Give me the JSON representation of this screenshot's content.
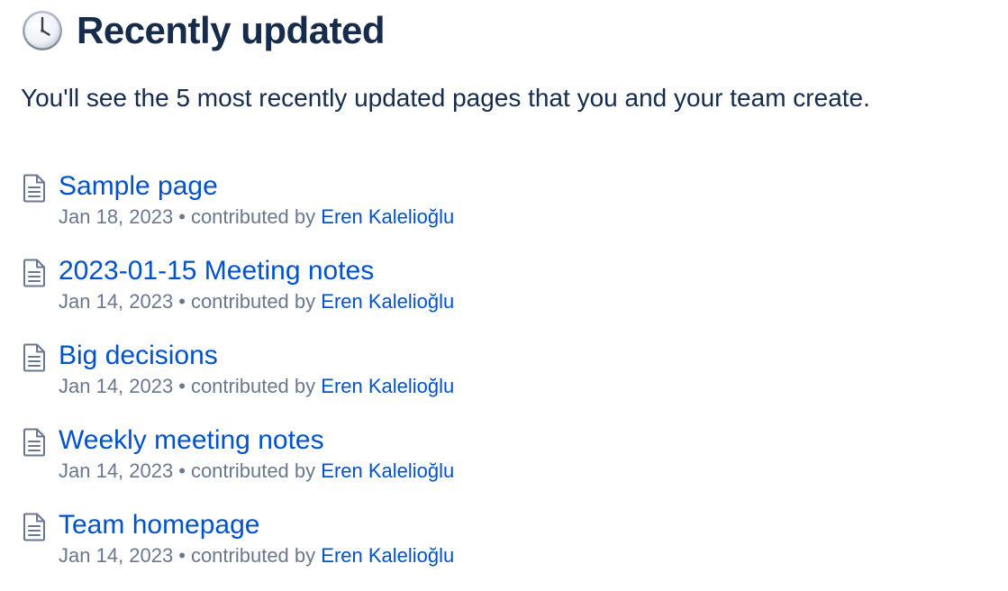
{
  "header": {
    "icon": "clock-icon",
    "title": "Recently updated"
  },
  "subtitle": "You'll see the 5 most recently updated pages that you and your team create.",
  "pages": [
    {
      "title": "Sample page",
      "date": "Jan 18, 2023",
      "separator": "•",
      "contributed_label": "contributed by",
      "author": "Eren Kalelioğlu",
      "icon": "page-icon"
    },
    {
      "title": "2023-01-15 Meeting notes",
      "date": "Jan 14, 2023",
      "separator": "•",
      "contributed_label": "contributed by",
      "author": "Eren Kalelioğlu",
      "icon": "page-icon"
    },
    {
      "title": "Big decisions",
      "date": "Jan 14, 2023",
      "separator": "•",
      "contributed_label": "contributed by",
      "author": "Eren Kalelioğlu",
      "icon": "page-icon"
    },
    {
      "title": "Weekly meeting notes",
      "date": "Jan 14, 2023",
      "separator": "•",
      "contributed_label": "contributed by",
      "author": "Eren Kalelioğlu",
      "icon": "page-icon"
    },
    {
      "title": "Team homepage",
      "date": "Jan 14, 2023",
      "separator": "•",
      "contributed_label": "contributed by",
      "author": "Eren Kalelioğlu",
      "icon": "page-icon"
    }
  ],
  "colors": {
    "heading": "#172b4d",
    "link": "#0052cc",
    "meta": "#6b778c"
  }
}
